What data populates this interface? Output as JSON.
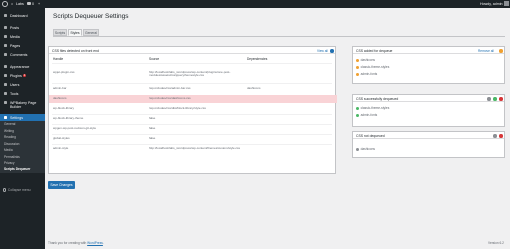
{
  "adminbar": {
    "site_name": "Labs",
    "comments_count": "0",
    "new_label": "+",
    "greeting": "Howdy, admin"
  },
  "sidebar": {
    "items": [
      {
        "label": "Dashboard",
        "icon": "dashboard-icon"
      },
      {
        "label": "Posts",
        "icon": "posts-icon"
      },
      {
        "label": "Media",
        "icon": "media-icon"
      },
      {
        "label": "Pages",
        "icon": "pages-icon"
      },
      {
        "label": "Comments",
        "icon": "comments-icon"
      },
      {
        "label": "Appearance",
        "icon": "appearance-icon"
      },
      {
        "label": "Plugins",
        "icon": "plugins-icon",
        "badge": "1"
      },
      {
        "label": "Users",
        "icon": "users-icon"
      },
      {
        "label": "Tools",
        "icon": "tools-icon"
      },
      {
        "label": "WPBakery Page Builder",
        "icon": "wpbakery-icon"
      },
      {
        "label": "Settings",
        "icon": "settings-icon"
      }
    ],
    "submenu": [
      "General",
      "Writing",
      "Reading",
      "Discussion",
      "Media",
      "Permalinks",
      "Privacy",
      "Scripts Dequeuer"
    ],
    "collapse_label": "Collapse menu"
  },
  "page": {
    "title": "Scripts Dequeuer Settings",
    "tabs": [
      "Scripts",
      "Styles",
      "General"
    ],
    "active_tab": "Styles"
  },
  "detected": {
    "title": "CSS files detected on front end",
    "action": "View all",
    "headers": [
      "Handle",
      "Source",
      "Dependencies"
    ],
    "rows": [
      {
        "handle": "wpjet-plugin-css",
        "source": "http://localhost/labs_/wordpress/wp-content/plugins/one-post-modules/assets/css/jquerythemestyle.css",
        "deps": ""
      },
      {
        "handle": "admin-bar",
        "source": "/wp-includes/css/admin-bar.css",
        "deps": "dashicons"
      },
      {
        "handle": "dashicons",
        "source": "/wp-includes/css/dashicons.css",
        "deps": ""
      },
      {
        "handle": "wp-block-library",
        "source": "/wp-includes/css/dist/block-library/style.css",
        "deps": ""
      },
      {
        "handle": "wp-block-library-theme",
        "source": "false",
        "deps": ""
      },
      {
        "handle": "wpgen-wp-post-revision-git-style",
        "source": "false",
        "deps": ""
      },
      {
        "handle": "global-styles",
        "source": "false",
        "deps": ""
      },
      {
        "handle": "admin-style",
        "source": "http://localhost/labs_/wordpress/wp-content/themes/custom/style.css",
        "deps": ""
      }
    ]
  },
  "added": {
    "title": "CSS added for dequeue",
    "action": "Remove all",
    "items": [
      "dashicons",
      "classic-theme-styles",
      "admin-fonts"
    ]
  },
  "dequeued": {
    "title": "CSS successfully dequeued",
    "items": [
      "classic-theme-styles",
      "admin-fonts"
    ]
  },
  "not_dequeued": {
    "title": "CSS not dequeued",
    "items": [
      "dashicons"
    ]
  },
  "save_label": "Save Changes",
  "footer": {
    "text": "Thank you for creating with",
    "link": "WordPress",
    "version": "Version 6.2"
  },
  "colors": {
    "accent": "#2271b1",
    "highlight_row": "#f9d3d6",
    "sidebar_bg": "#1d2327"
  }
}
